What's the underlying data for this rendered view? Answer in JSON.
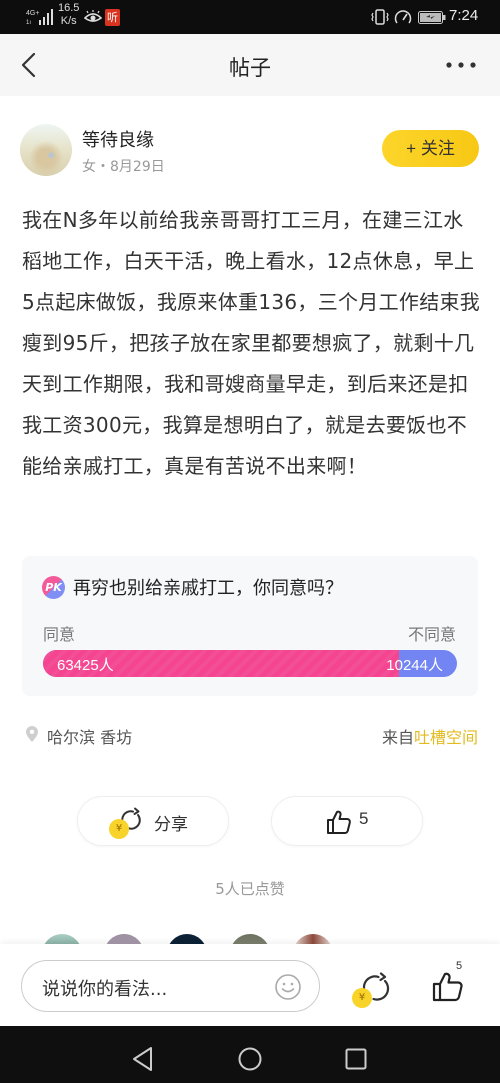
{
  "status_bar": {
    "network": "4G+",
    "speed_value": "16.5",
    "speed_unit": "K/s",
    "listen_badge": "听",
    "time": "7:24"
  },
  "nav": {
    "title": "帖子",
    "back_icon": "chevron-left-icon",
    "more_icon": "more-dots-icon"
  },
  "author": {
    "name": "等待良缘",
    "meta": "女・8月29日",
    "follow_label": "+ 关注"
  },
  "post": {
    "body": "我在N多年以前给我亲哥哥打工三月，在建三江水稻地工作，白天干活，晚上看水，12点休息，早上5点起床做饭，我原来体重136，三个月工作结束我瘦到95斤，把孩子放在家里都要想疯了，就剩十几天到工作期限，我和哥嫂商量早走，到后来还是扣我工资300元，我算是想明白了，就是去要饭也不能给亲戚打工，真是有苦说不出来啊！"
  },
  "poll": {
    "badge": "PK",
    "question": "再穷也别给亲戚打工，你同意吗？",
    "agree_label": "同意",
    "disagree_label": "不同意",
    "agree_count": 63425,
    "disagree_count": 10244,
    "agree_text": "63425人",
    "disagree_text": "10244人",
    "colors": {
      "agree": "#f54591",
      "disagree": "#7285f2"
    }
  },
  "location": {
    "text": "哈尔滨 香坊",
    "source_prefix": "来自",
    "source_link": "吐槽空间"
  },
  "actions": {
    "share_label": "分享",
    "coin_symbol": "¥",
    "like_count": "5",
    "likes_summary": "5人已点赞"
  },
  "comment_bar": {
    "placeholder": "说说你的看法...",
    "coin_symbol": "¥",
    "like_count": "5"
  },
  "colors": {
    "accent_yellow": "#f8d42a",
    "link_yellow": "#e2bb1f"
  }
}
